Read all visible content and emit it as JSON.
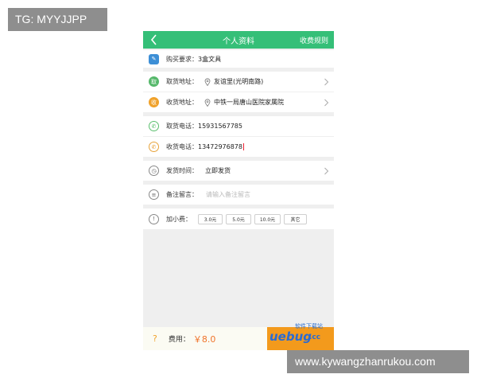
{
  "watermarks": {
    "top_left": "TG: MYYJJPP",
    "bottom_right": "www.kywangzhanrukou.com"
  },
  "header": {
    "back_icon": "chevron-left-icon",
    "title": "个人资料",
    "rules": "收费规则"
  },
  "form": {
    "purchase": {
      "label": "购买要求：",
      "value": "3盒文具"
    },
    "pickup_address": {
      "label": "取货地址：",
      "value": "友谊里(光明南路)"
    },
    "delivery_address": {
      "label": "收货地址：",
      "value": "中铁一局唐山医院家属院"
    },
    "pickup_phone": {
      "label": "取货电话：",
      "value": "15931567785"
    },
    "delivery_phone": {
      "label": "收货电话：",
      "value": "13472976878"
    },
    "send_time": {
      "label": "发货时间：",
      "value": "立即发货"
    },
    "remark": {
      "label": "备注留言：",
      "placeholder": "请输入备注留言"
    },
    "tip": {
      "label": "加小费：",
      "options": [
        "3.0元",
        "5.0元",
        "10.0元",
        "其它"
      ]
    }
  },
  "footer": {
    "help_icon": "?",
    "fee_label": "费用：",
    "fee_value": "￥8.0"
  },
  "logo": {
    "tagline": "软件下载站",
    "brand": "uebug",
    "suffix": ".cc"
  },
  "colors": {
    "header_green": "#35bf78",
    "accent_orange": "#f39a1c",
    "price_orange": "#f0742b"
  }
}
